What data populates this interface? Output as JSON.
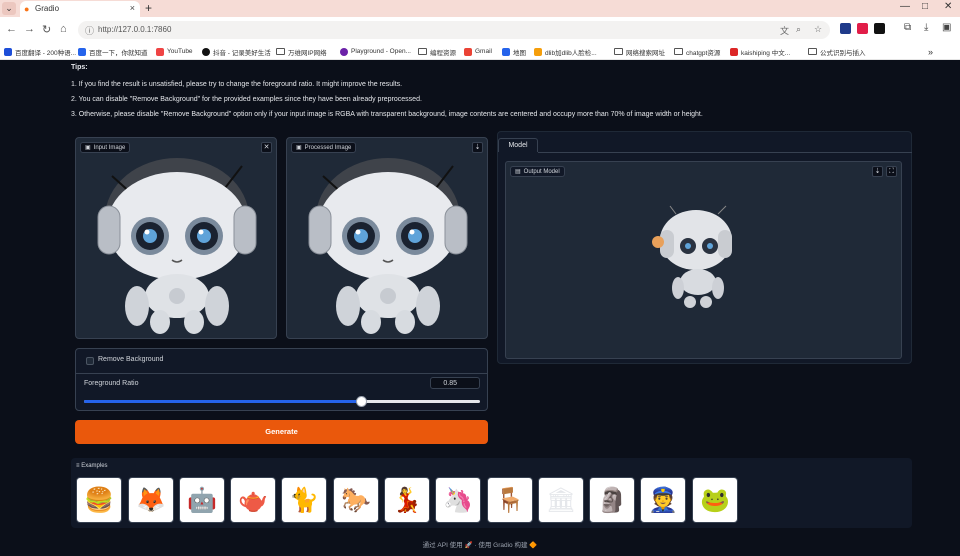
{
  "browser": {
    "tab_title": "Gradio",
    "tab_menu_glyph": "⌄",
    "new_tab_glyph": "+",
    "window_controls": [
      "—",
      "□",
      "✕"
    ],
    "url": "http://127.0.0.1:7860",
    "bookmarks": [
      "百度翻译 - 200种语...",
      "百度一下，你就知道",
      "YouTube",
      "抖音 - 记录美好生活",
      "万维网IP网络",
      "Playground - Open...",
      "编程资源",
      "Gmail",
      "地图",
      "dlib加dlib人脸检...",
      "网络搜索网址",
      "chatgpt资源",
      "kaishiping 中文...",
      "公式识别与插入"
    ],
    "more_glyph": "»",
    "bookmark_colors": [
      "#1d4ed8",
      "#2563eb",
      "#ef4444",
      "#111111",
      "#555555",
      "#6b21a8",
      "#555555",
      "#ea4335",
      "#2563eb",
      "#f59e0b",
      "#555555",
      "#555555",
      "#dc2626",
      "#555555"
    ]
  },
  "tips": {
    "title": "Tips:",
    "lines": [
      "1. If you find the result is unsatisfied, please try to change the foreground ratio. It might improve the results.",
      "2. You can disable \"Remove Background\" for the provided examples since they have been already preprocessed.",
      "3. Otherwise, please disable \"Remove Background\" option only if your input image is RGBA with transparent background, image contents are centered and occupy more than 70% of image width or height."
    ]
  },
  "input_image": {
    "label": "Input Image",
    "close_glyph": "✕"
  },
  "processed_image": {
    "label": "Processed Image",
    "download_glyph": "⇣"
  },
  "options": {
    "remove_background_label": "Remove Background",
    "remove_background_checked": false,
    "foreground_ratio_label": "Foreground Ratio",
    "foreground_ratio_value": "0.85",
    "foreground_ratio_fraction": 0.7
  },
  "generate_label": "Generate",
  "model": {
    "tab_label": "Model",
    "output_label": "Output Model",
    "download_glyph": "⇣",
    "expand_glyph": "⛶"
  },
  "examples": {
    "label": "Examples",
    "items": [
      "hamburger",
      "fox",
      "robot",
      "teapot",
      "cat-figure",
      "horse",
      "dancer",
      "unicorn",
      "chair",
      "ruins",
      "statue",
      "police-officer",
      "frog"
    ],
    "glyphs": [
      "🍔",
      "🦊",
      "🤖",
      "🫖",
      "🐈",
      "🐎",
      "💃",
      "🦄",
      "🪑",
      "🏛",
      "🗿",
      "👮",
      "🐸"
    ]
  },
  "footer": "通过 API 使用 🚀 · 使用 Gradio 构建 🔶",
  "colors": {
    "accent": "#ea580c",
    "slider": "#2563eb",
    "bg": "#0b0f19"
  }
}
